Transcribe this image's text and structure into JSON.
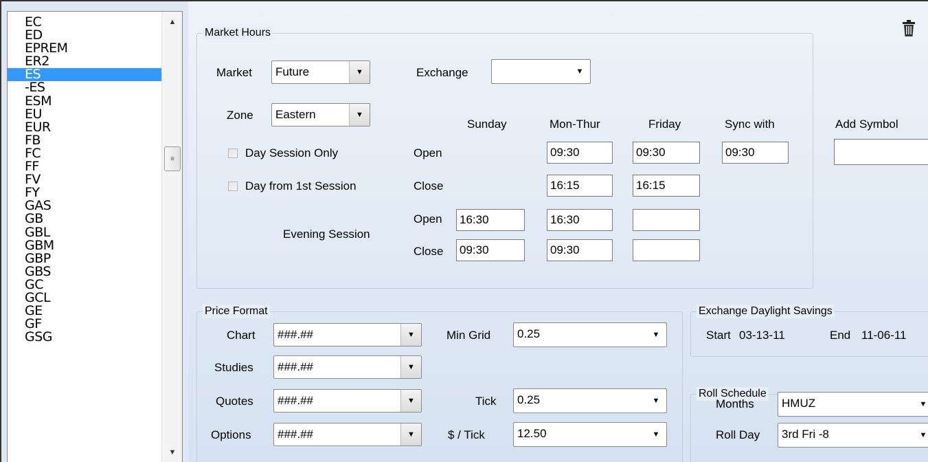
{
  "symbols": [
    "EC",
    "ED",
    "EPREM",
    "ER2",
    "ES",
    "-ES",
    "ESM",
    "EU",
    "EUR",
    "FB",
    "FC",
    "FF",
    "FV",
    "FY",
    "GAS",
    "GB",
    "GBL",
    "GBM",
    "GBP",
    "GBS",
    "GC",
    "GCL",
    "GE",
    "GF",
    "GSG"
  ],
  "selected_symbol": "ES",
  "market_hours": {
    "title": "Market Hours",
    "market_label": "Market",
    "market_value": "Future",
    "exchange_label": "Exchange",
    "exchange_value": "",
    "zone_label": "Zone",
    "zone_value": "Eastern",
    "day_session_only": "Day Session Only",
    "day_from_first_session": "Day from 1st Session",
    "evening_session": "Evening Session",
    "col_sunday": "Sunday",
    "col_monthur": "Mon-Thur",
    "col_friday": "Friday",
    "col_sync": "Sync with",
    "open_label": "Open",
    "close_label": "Close",
    "day_open_monthur": "09:30",
    "day_open_friday": "09:30",
    "day_open_sync": "09:30",
    "day_close_monthur": "16:15",
    "day_close_friday": "16:15",
    "eve_open_sunday": "16:30",
    "eve_open_monthur": "16:30",
    "eve_open_friday": "",
    "eve_close_sunday": "09:30",
    "eve_close_monthur": "09:30",
    "eve_close_friday": ""
  },
  "add_symbol": {
    "label": "Add Symbol",
    "value": ""
  },
  "price_format": {
    "title": "Price Format",
    "chart_label": "Chart",
    "chart_value": "###.##",
    "studies_label": "Studies",
    "studies_value": "###.##",
    "quotes_label": "Quotes",
    "quotes_value": "###.##",
    "options_label": "Options",
    "options_value": "###.##",
    "min_grid_label": "Min Grid",
    "min_grid_value": "0.25",
    "tick_label": "Tick",
    "tick_value": "0.25",
    "dollar_tick_label": "$ / Tick",
    "dollar_tick_value": "12.50"
  },
  "daylight_savings": {
    "title": "Exchange Daylight Savings",
    "start_label": "Start",
    "start_value": "03-13-11",
    "end_label": "End",
    "end_value": "11-06-11"
  },
  "roll_schedule": {
    "title": "Roll Schedule",
    "months_label": "Months",
    "months_value": "HMUZ",
    "roll_day_label": "Roll Day",
    "roll_day_value": "3rd Fri -8"
  },
  "icons": {
    "delete": "trash-icon",
    "dropdown": "chevron-down-icon"
  }
}
